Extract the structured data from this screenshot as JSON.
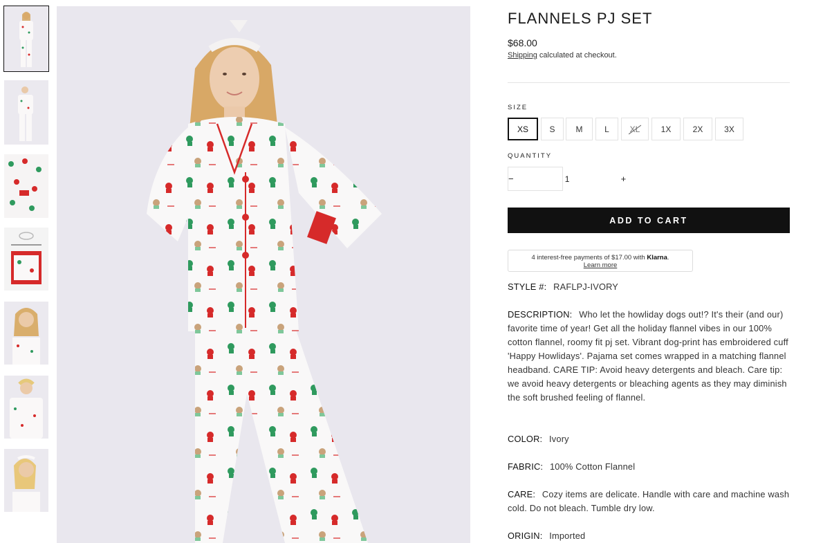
{
  "product": {
    "title": "FLANNELS PJ SET",
    "price": "$68.00",
    "shipping_link": "Shipping",
    "shipping_rest": " calculated at checkout."
  },
  "size": {
    "label": "SIZE",
    "options": [
      "XS",
      "S",
      "M",
      "L",
      "XL",
      "1X",
      "2X",
      "3X"
    ],
    "selected": "XS",
    "sold_out": [
      "XL"
    ]
  },
  "quantity": {
    "label": "QUANTITY",
    "minus": "−",
    "plus": "+",
    "value": "1"
  },
  "cart": {
    "label": "ADD TO CART"
  },
  "klarna": {
    "text_before": "4 interest-free payments of $17.00 with ",
    "brand": "Klarna",
    "text_after": ".",
    "link": "Learn more"
  },
  "details": [
    {
      "key": "STYLE #:",
      "value": "RAFLPJ-IVORY"
    },
    {
      "key": "DESCRIPTION:",
      "value": "Who let the howliday dogs out!? It's their (and our) favorite time of year! Get all the holiday flannel vibes in our 100% cotton flannel, roomy fit pj set. Vibrant dog-print has embroidered cuff 'Happy Howlidays'. Pajama set comes wrapped in a matching flannel headband. CARE TIP: Avoid heavy detergents and bleach. Care tip: we avoid heavy detergents or bleaching agents as they may diminish the soft brushed feeling of flannel."
    },
    {
      "key": "COLOR:",
      "value": "Ivory"
    },
    {
      "key": "FABRIC:",
      "value": "100% Cotton Flannel"
    },
    {
      "key": "CARE:",
      "value": "Cozy items are delicate. Handle with care and machine wash cold. Do not bleach. Tumble dry low."
    },
    {
      "key": "ORIGIN:",
      "value": "Imported"
    }
  ],
  "colors": {
    "button_bg": "#111111",
    "pajama_red": "#d62a2a",
    "pajama_green": "#2f9a5e",
    "backdrop": "#e9e7ee"
  }
}
